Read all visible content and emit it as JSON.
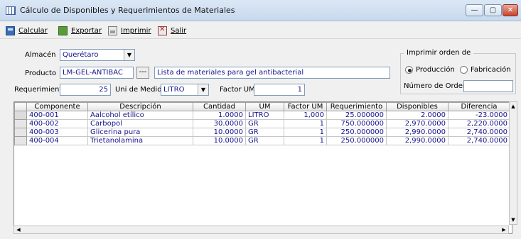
{
  "window": {
    "title": "Cálculo de Disponibles y Requerimientos de Materiales",
    "minimize": "—",
    "maximize": "▢",
    "close": "✕"
  },
  "toolbar": {
    "calcular": "Calcular",
    "exportar": "Exportar",
    "imprimir": "Imprimir",
    "salir": "Salir"
  },
  "form": {
    "almacen_label": "Almacén",
    "almacen_value": "Querétaro",
    "producto_label": "Producto",
    "producto_code": "LM-GEL-ANTIBAC",
    "producto_desc": "Lista de materiales para gel antibacterial",
    "lookup_button": "---",
    "requerimiento_label": "Requerimiento",
    "requerimiento_value": "25",
    "unidad_label": "Uni de Medida",
    "unidad_value": "LITRO",
    "factor_label": "Factor UM",
    "factor_value": "1"
  },
  "print_group": {
    "title": "Imprimir orden de",
    "option_produccion": "Producción",
    "option_fabricacion": "Fabricación",
    "selected": "Producción",
    "numero_orden_label": "Número de Orden",
    "numero_orden_value": ""
  },
  "table": {
    "headers": [
      "Componente",
      "Descripción",
      "Cantidad",
      "UM",
      "Factor UM",
      "Requerimiento",
      "Disponibles",
      "Diferencia"
    ],
    "rows": [
      [
        "400-001",
        "Aalcohol etílico",
        "1.0000",
        "LITRO",
        "1,000",
        "25.000000",
        "2.0000",
        "-23.0000"
      ],
      [
        "400-002",
        "Carbopol",
        "30.0000",
        "GR",
        "1",
        "750.000000",
        "2,970.0000",
        "2,220.0000"
      ],
      [
        "400-003",
        "Glicerina pura",
        "10.0000",
        "GR",
        "1",
        "250.000000",
        "2,990.0000",
        "2,740.0000"
      ],
      [
        "400-004",
        "Trietanolamina",
        "10.0000",
        "GR",
        "1",
        "250.000000",
        "2,990.0000",
        "2,740.0000"
      ]
    ]
  },
  "icons": {
    "calcular": "calculator-icon",
    "exportar": "export-icon",
    "imprimir": "printer-icon",
    "salir": "exit-icon"
  }
}
